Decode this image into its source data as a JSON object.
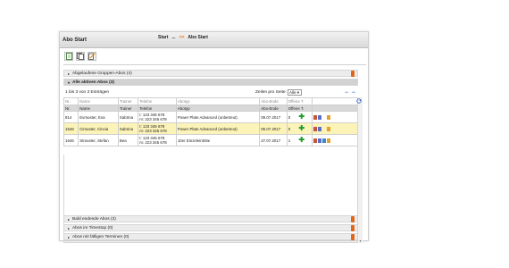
{
  "window": {
    "title": "Abo Start"
  },
  "breadcrumb": {
    "first": "Start",
    "dots": "...",
    "sep": ">>",
    "current": "Abo Start"
  },
  "toolbar": {
    "icons": [
      "document-icon",
      "copy-icon",
      "edit-icon"
    ]
  },
  "sections": {
    "expired": "Abgelaufene Gruppen-Abos (4)",
    "active": "Alle aktiven Abos (3)",
    "ending": "Bald endende Abos (3)",
    "timestop": "Abos im Timestop (0)",
    "due": "Abos mit fälligen Terminen (0)"
  },
  "list": {
    "count_text": "1 bis 3 von 3 Einträgen",
    "per_page_label": "Zeilen pro Seite:",
    "per_page_value": "Alle"
  },
  "filters": [
    "Nr.",
    "Name",
    "Trainer",
    "Telefon",
    "Abotyp",
    "Abo-Ende",
    "Offene T."
  ],
  "columns": [
    "Nr.",
    "Name",
    "Trainer",
    "Telefon",
    "Abotyp",
    "Abo-Ende",
    "Offene T."
  ],
  "rows": [
    {
      "nr": "814",
      "name": "Evmuster, Eva",
      "trainer": "Sabrina",
      "tel1": "t: 123 345 678",
      "tel2": "m: 223 345 678",
      "abotyp": "Power Plate Advanced (unbetreut)",
      "ende": "09.07.2017",
      "offen": "0"
    },
    {
      "nr": "1546",
      "name": "Cimuster, Cincia",
      "trainer": "Sabrina",
      "tel1": "t: 123 345 678",
      "tel2": "m: 223 345 678",
      "abotyp": "Power Plate Advanced (unbetreut)",
      "ende": "05.07.2017",
      "offen": "0"
    },
    {
      "nr": "1646",
      "name": "Stmuster, Stefan",
      "trainer": "Bea",
      "tel1": "t: 123 345 678",
      "tel2": "m: 223 345 678",
      "abotyp": "10er Einzeleintritte",
      "ende": "27.07.2017",
      "offen": "1"
    }
  ],
  "colors": {
    "accent": "#e0661a",
    "highlight_row": "#fbf3b8",
    "add_green": "#1e9a2b"
  }
}
